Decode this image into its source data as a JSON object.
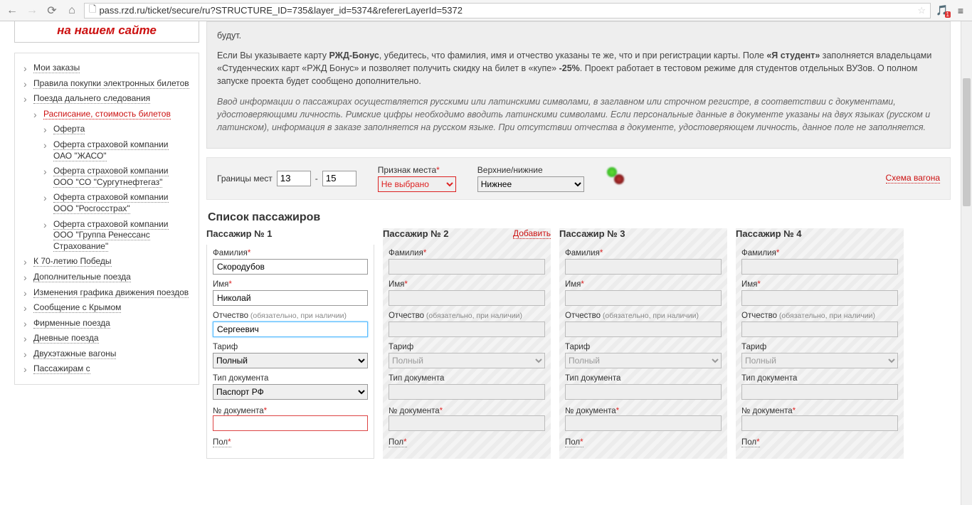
{
  "browser": {
    "url": "pass.rzd.ru/ticket/secure/ru?STRUCTURE_ID=735&layer_id=5374&refererLayerId=5372",
    "ext_badge": "1"
  },
  "sidebar": {
    "promo": "на нашем сайте",
    "items": [
      {
        "label": "Мои заказы"
      },
      {
        "label": "Правила покупки электронных билетов"
      },
      {
        "label": "Поезда дальнего следования"
      },
      {
        "label": "К 70-летию Победы"
      },
      {
        "label": "Дополнительные поезда"
      },
      {
        "label": "Изменения графика движения поездов"
      },
      {
        "label": "Сообщение с Крымом"
      },
      {
        "label": "Фирменные поезда"
      },
      {
        "label": "Дневные поезда"
      },
      {
        "label": "Двухэтажные вагоны"
      },
      {
        "label": "Пассажирам с"
      }
    ],
    "sub_long": {
      "schedule": "Расписание, стоимость билетов",
      "offer": "Оферта",
      "ins1a": "Оферта страховой компании",
      "ins1b": "ОАО \"ЖАСО\"",
      "ins2a": "Оферта страховой компании",
      "ins2b": "ООО \"СО \"Сургутнефтегаз\"",
      "ins3a": "Оферта страховой компании",
      "ins3b": "ООО \"Росгосстрах\"",
      "ins4a": "Оферта страховой компании",
      "ins4b": "ООО \"Группа Ренессанс Страхование\""
    }
  },
  "info": {
    "tail": "будут.",
    "p2a": "Если Вы указываете карту ",
    "p2b": "РЖД-Бонус",
    "p2c": ", убедитесь, что фамилия, имя и отчество указаны те же, что и при регистрации карты. Поле ",
    "p2d": "«Я студент»",
    "p2e": " заполняется владельцами «Студенческих карт «РЖД Бонус» и позволяет получить скидку на билет в «купе» ",
    "p2f": "-25%",
    "p2g": ". Проект работает в тестовом режиме для студентов отдельных ВУЗов. О полном запуске проекта будет сообщено дополнительно.",
    "p3": "Ввод информации о пассажирах осуществляется русскими или латинскими символами, в заглавном или строчном регистре, в соответствии с документами, удостоверяющими личность. Римские цифры необходимо вводить латинскими символами. Если персональные данные в документе указаны на двух языках (русском и латинском), информация в заказе заполняется на русском языке. При отсутствии отчества в документе, удостоверяющем личность, данное поле не заполняется."
  },
  "seat": {
    "range_label": "Границы мест",
    "from": "13",
    "to": "15",
    "sign_label": "Признак места",
    "sign_value": "Не выбрано",
    "updown_label": "Верхние/нижние",
    "updown_value": "Нижнее",
    "wagon_link": "Схема вагона"
  },
  "passengers_title": "Список пассажиров",
  "labels": {
    "lastname": "Фамилия",
    "firstname": "Имя",
    "middlename": "Отчество",
    "middlename_hint": "(обязательно, при наличии)",
    "tariff": "Тариф",
    "doctype": "Тип документа",
    "docnum": "№ документа",
    "gender": "Пол",
    "add": "Добавить"
  },
  "tariff_default": "Полный",
  "doctype_default": "Паспорт РФ",
  "p": [
    {
      "title": "Пассажир № 1",
      "active": true,
      "lastname": "Скородубов",
      "firstname": "Николай",
      "middlename": "Сергеевич",
      "tariff": "Полный",
      "doctype": "Паспорт РФ",
      "docnum": ""
    },
    {
      "title": "Пассажир № 2",
      "active": false,
      "lastname": "",
      "firstname": "",
      "middlename": "",
      "tariff": "Полный",
      "doctype": "",
      "docnum": ""
    },
    {
      "title": "Пассажир № 3",
      "active": false,
      "lastname": "",
      "firstname": "",
      "middlename": "",
      "tariff": "Полный",
      "doctype": "",
      "docnum": ""
    },
    {
      "title": "Пассажир № 4",
      "active": false,
      "lastname": "",
      "firstname": "",
      "middlename": "",
      "tariff": "Полный",
      "doctype": "",
      "docnum": ""
    }
  ]
}
